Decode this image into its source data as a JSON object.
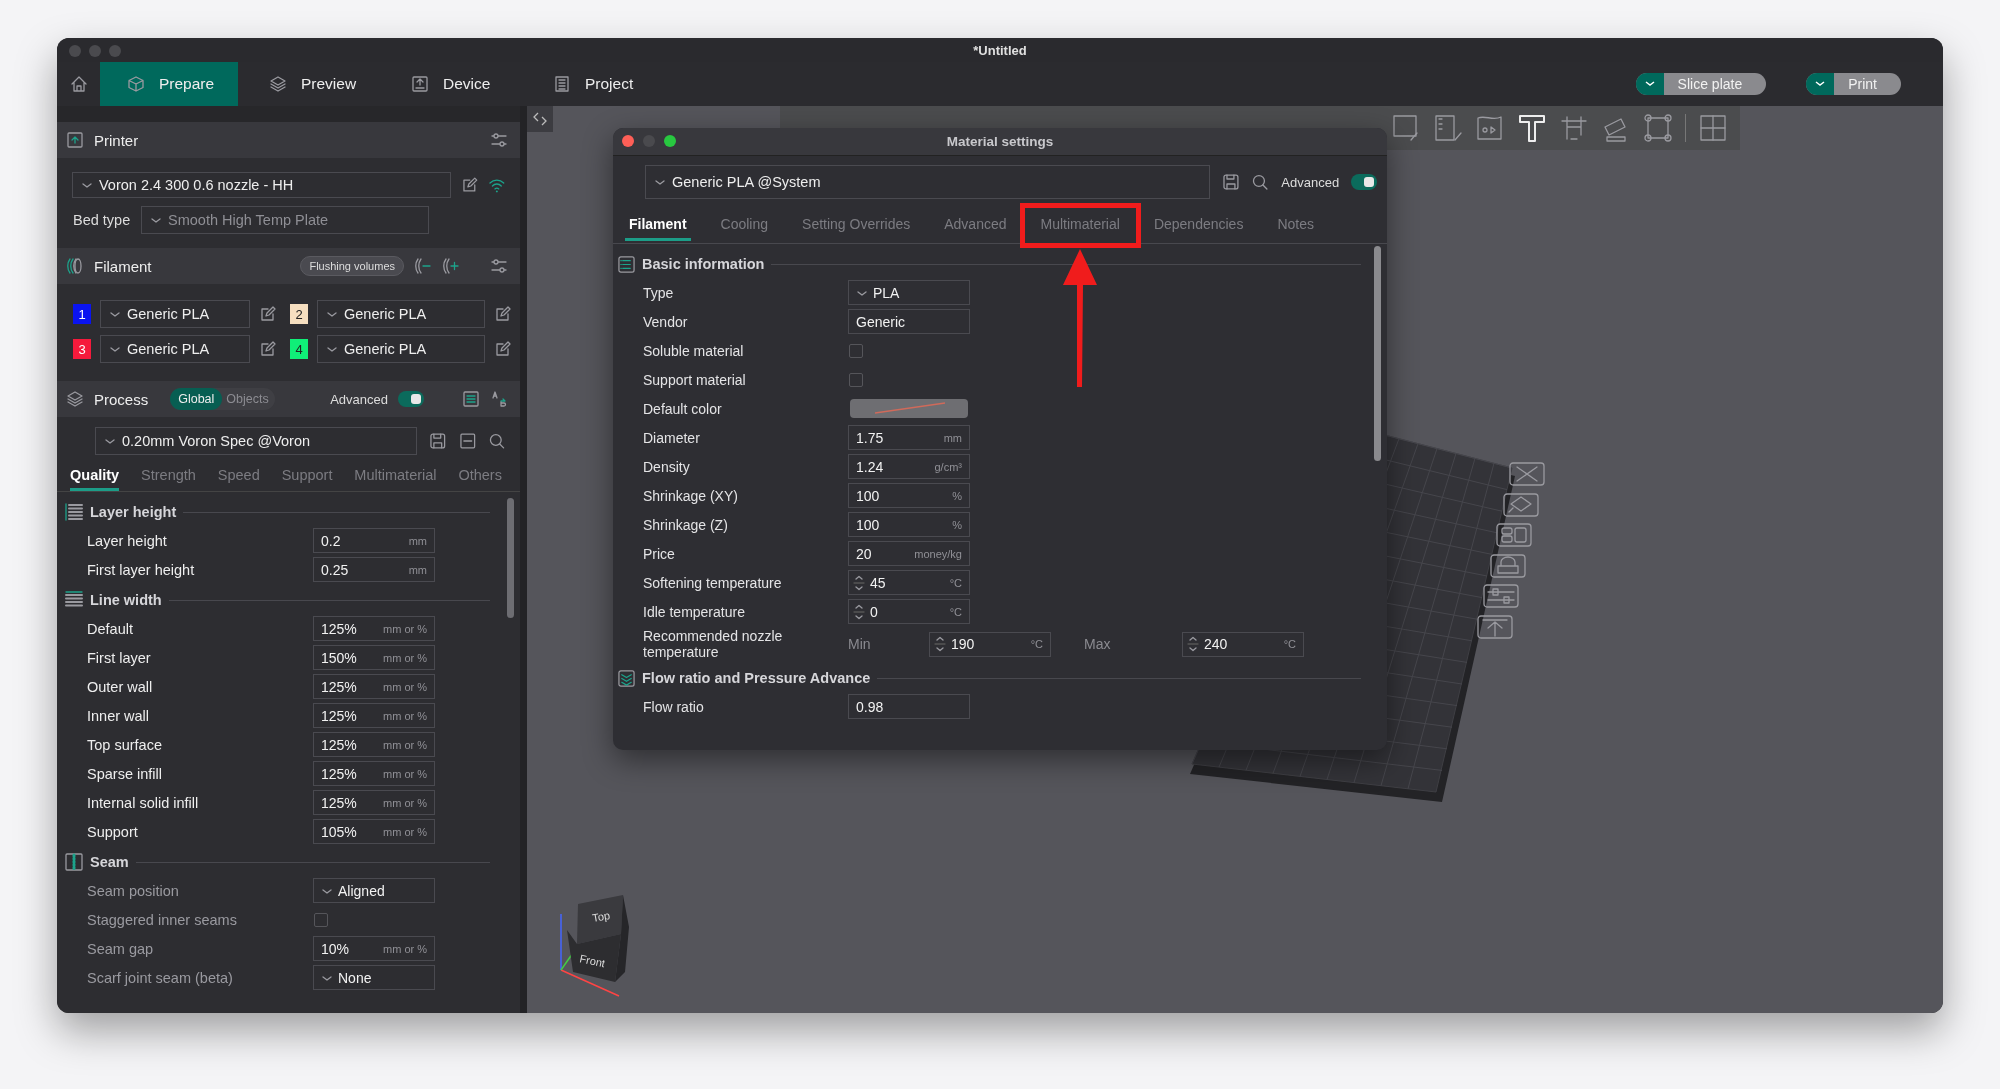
{
  "window": {
    "title": "*Untitled"
  },
  "nav_tabs": [
    {
      "label": "Prepare",
      "selected": true
    },
    {
      "label": "Preview",
      "selected": false
    },
    {
      "label": "Device",
      "selected": false
    },
    {
      "label": "Project",
      "selected": false
    }
  ],
  "actions": [
    {
      "label": "Slice plate"
    },
    {
      "label": "Print"
    }
  ],
  "sidebar": {
    "printer": {
      "title": "Printer",
      "preset": "Voron 2.4 300 0.6 nozzle - HH",
      "bed_type_label": "Bed type",
      "bed_type": "Smooth High Temp Plate"
    },
    "filament": {
      "title": "Filament",
      "flushing_button": "Flushing volumes",
      "slots": [
        {
          "number": "1",
          "color": "#0a14f0",
          "name": "Generic PLA"
        },
        {
          "number": "2",
          "color": "#f6dfc0",
          "name": "Generic PLA"
        },
        {
          "number": "3",
          "color": "#f51a3c",
          "name": "Generic PLA"
        },
        {
          "number": "4",
          "color": "#10ef78",
          "name": "Generic PLA"
        }
      ]
    },
    "process": {
      "title": "Process",
      "scope": [
        {
          "label": "Global",
          "selected": true
        },
        {
          "label": "Objects",
          "selected": false
        }
      ],
      "advanced_label": "Advanced",
      "advanced_on": true,
      "preset": "0.20mm Voron Spec @Voron",
      "tabs": [
        {
          "label": "Quality",
          "selected": true
        },
        {
          "label": "Strength",
          "selected": false
        },
        {
          "label": "Speed",
          "selected": false
        },
        {
          "label": "Support",
          "selected": false
        },
        {
          "label": "Multimaterial",
          "selected": false
        },
        {
          "label": "Others",
          "selected": false
        }
      ],
      "groups": [
        {
          "title": "Layer height",
          "settings": [
            {
              "kind": "input",
              "label": "Layer height",
              "value": "0.2",
              "unit": "mm",
              "dimmed": false
            },
            {
              "kind": "input",
              "label": "First layer height",
              "value": "0.25",
              "unit": "mm",
              "dimmed": false
            }
          ]
        },
        {
          "title": "Line width",
          "settings": [
            {
              "kind": "input",
              "label": "Default",
              "value": "125%",
              "unit": "mm or %",
              "dimmed": false
            },
            {
              "kind": "input",
              "label": "First layer",
              "value": "150%",
              "unit": "mm or %",
              "dimmed": false
            },
            {
              "kind": "input",
              "label": "Outer wall",
              "value": "125%",
              "unit": "mm or %",
              "dimmed": false
            },
            {
              "kind": "input",
              "label": "Inner wall",
              "value": "125%",
              "unit": "mm or %",
              "dimmed": false
            },
            {
              "kind": "input",
              "label": "Top surface",
              "value": "125%",
              "unit": "mm or %",
              "dimmed": false
            },
            {
              "kind": "input",
              "label": "Sparse infill",
              "value": "125%",
              "unit": "mm or %",
              "dimmed": false
            },
            {
              "kind": "input",
              "label": "Internal solid infill",
              "value": "125%",
              "unit": "mm or %",
              "dimmed": false
            },
            {
              "kind": "input",
              "label": "Support",
              "value": "105%",
              "unit": "mm or %",
              "dimmed": false
            }
          ]
        },
        {
          "title": "Seam",
          "settings": [
            {
              "kind": "select",
              "label": "Seam position",
              "value": "Aligned",
              "dimmed": true
            },
            {
              "kind": "checkbox",
              "label": "Staggered inner seams",
              "checked": false,
              "dimmed": true
            },
            {
              "kind": "input",
              "label": "Seam gap",
              "value": "10%",
              "unit": "mm or %",
              "dimmed": true
            },
            {
              "kind": "select",
              "label": "Scarf joint seam (beta)",
              "value": "None",
              "dimmed": true
            }
          ]
        }
      ]
    }
  },
  "viewport": {
    "view_cube": {
      "top": "Top",
      "front": "Front"
    }
  },
  "material_dialog": {
    "title": "Material settings",
    "preset": "Generic PLA @System",
    "advanced_label": "Advanced",
    "advanced_on": true,
    "tabs": [
      {
        "label": "Filament",
        "selected": true,
        "highlighted": false
      },
      {
        "label": "Cooling",
        "selected": false,
        "highlighted": false
      },
      {
        "label": "Setting Overrides",
        "selected": false,
        "highlighted": false
      },
      {
        "label": "Advanced",
        "selected": false,
        "highlighted": false
      },
      {
        "label": "Multimaterial",
        "selected": false,
        "highlighted": true
      },
      {
        "label": "Dependencies",
        "selected": false,
        "highlighted": false
      },
      {
        "label": "Notes",
        "selected": false,
        "highlighted": false
      }
    ],
    "groups": [
      {
        "title": "Basic information",
        "settings": [
          {
            "kind": "select",
            "label": "Type",
            "value": "PLA"
          },
          {
            "kind": "input",
            "label": "Vendor",
            "value": "Generic"
          },
          {
            "kind": "checkbox",
            "label": "Soluble material",
            "checked": false
          },
          {
            "kind": "checkbox",
            "label": "Support material",
            "checked": false
          },
          {
            "kind": "color",
            "label": "Default color"
          },
          {
            "kind": "input",
            "label": "Diameter",
            "value": "1.75",
            "unit": "mm"
          },
          {
            "kind": "input",
            "label": "Density",
            "value": "1.24",
            "unit": "g/cm³"
          },
          {
            "kind": "input",
            "label": "Shrinkage (XY)",
            "value": "100",
            "unit": "%"
          },
          {
            "kind": "input",
            "label": "Shrinkage (Z)",
            "value": "100",
            "unit": "%"
          },
          {
            "kind": "input",
            "label": "Price",
            "value": "20",
            "unit": "money/kg"
          },
          {
            "kind": "spin",
            "label": "Softening temperature",
            "value": "45",
            "unit": "°C"
          },
          {
            "kind": "spin",
            "label": "Idle temperature",
            "value": "0",
            "unit": "°C"
          },
          {
            "kind": "range",
            "label": "Recommended nozzle temperature",
            "min_label": "Min",
            "min": "190",
            "min_unit": "°C",
            "max_label": "Max",
            "max": "240",
            "max_unit": "°C"
          }
        ]
      },
      {
        "title": "Flow ratio and Pressure Advance",
        "settings": [
          {
            "kind": "input",
            "label": "Flow ratio",
            "value": "0.98"
          }
        ]
      }
    ]
  }
}
